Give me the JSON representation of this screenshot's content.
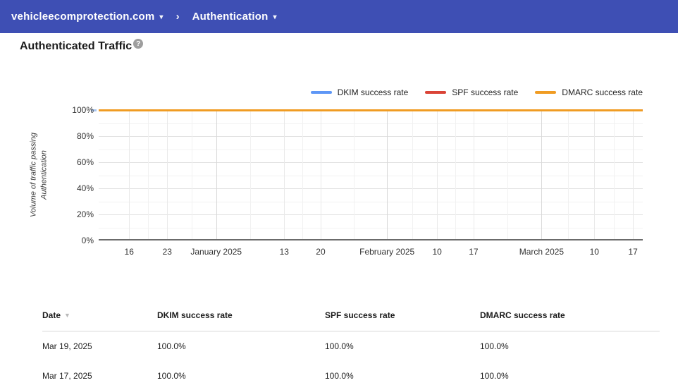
{
  "topbar": {
    "domain": "vehicleecomprotection.com",
    "section": "Authentication",
    "dropdown_arrow": "▾",
    "breadcrumb_chevron": "›"
  },
  "page": {
    "title": "Authenticated Traffic",
    "help_icon": "?"
  },
  "chart_data": {
    "type": "line",
    "title": "",
    "xlabel": "",
    "ylabel": "Volume of traffic passing\nAuthentication",
    "ylim": [
      0,
      100
    ],
    "y_ticks": [
      0,
      20,
      40,
      60,
      80,
      100
    ],
    "y_tick_suffix": "%",
    "grid": true,
    "legend_position": "top-right",
    "x_ticks": [
      {
        "label": "16",
        "pos": 0.056,
        "month": false
      },
      {
        "label": "23",
        "pos": 0.126,
        "month": false
      },
      {
        "label": "January 2025",
        "pos": 0.216,
        "month": true
      },
      {
        "label": "13",
        "pos": 0.341,
        "month": false
      },
      {
        "label": "20",
        "pos": 0.408,
        "month": false
      },
      {
        "label": "February 2025",
        "pos": 0.53,
        "month": true
      },
      {
        "label": "10",
        "pos": 0.622,
        "month": false
      },
      {
        "label": "17",
        "pos": 0.689,
        "month": false
      },
      {
        "label": "March 2025",
        "pos": 0.814,
        "month": true
      },
      {
        "label": "10",
        "pos": 0.911,
        "month": false
      },
      {
        "label": "17",
        "pos": 0.982,
        "month": false
      }
    ],
    "series": [
      {
        "name": "DKIM success rate",
        "color": "#5e97f6",
        "constant_value": 100
      },
      {
        "name": "SPF success rate",
        "color": "#da4437",
        "constant_value": 100
      },
      {
        "name": "DMARC success rate",
        "color": "#f09c23",
        "constant_value": 100
      }
    ]
  },
  "table": {
    "columns": [
      "Date",
      "DKIM success rate",
      "SPF success rate",
      "DMARC success rate"
    ],
    "sorted_column": "Date",
    "sort_icon": "▼",
    "rows": [
      [
        "Mar 19, 2025",
        "100.0%",
        "100.0%",
        "100.0%"
      ],
      [
        "Mar 17, 2025",
        "100.0%",
        "100.0%",
        "100.0%"
      ]
    ]
  },
  "colors": {
    "topbar_bg": "#3e4fb4",
    "dkim_blue": "#5e97f6",
    "spf_red": "#da4437",
    "dmarc_orange": "#f09c23"
  }
}
